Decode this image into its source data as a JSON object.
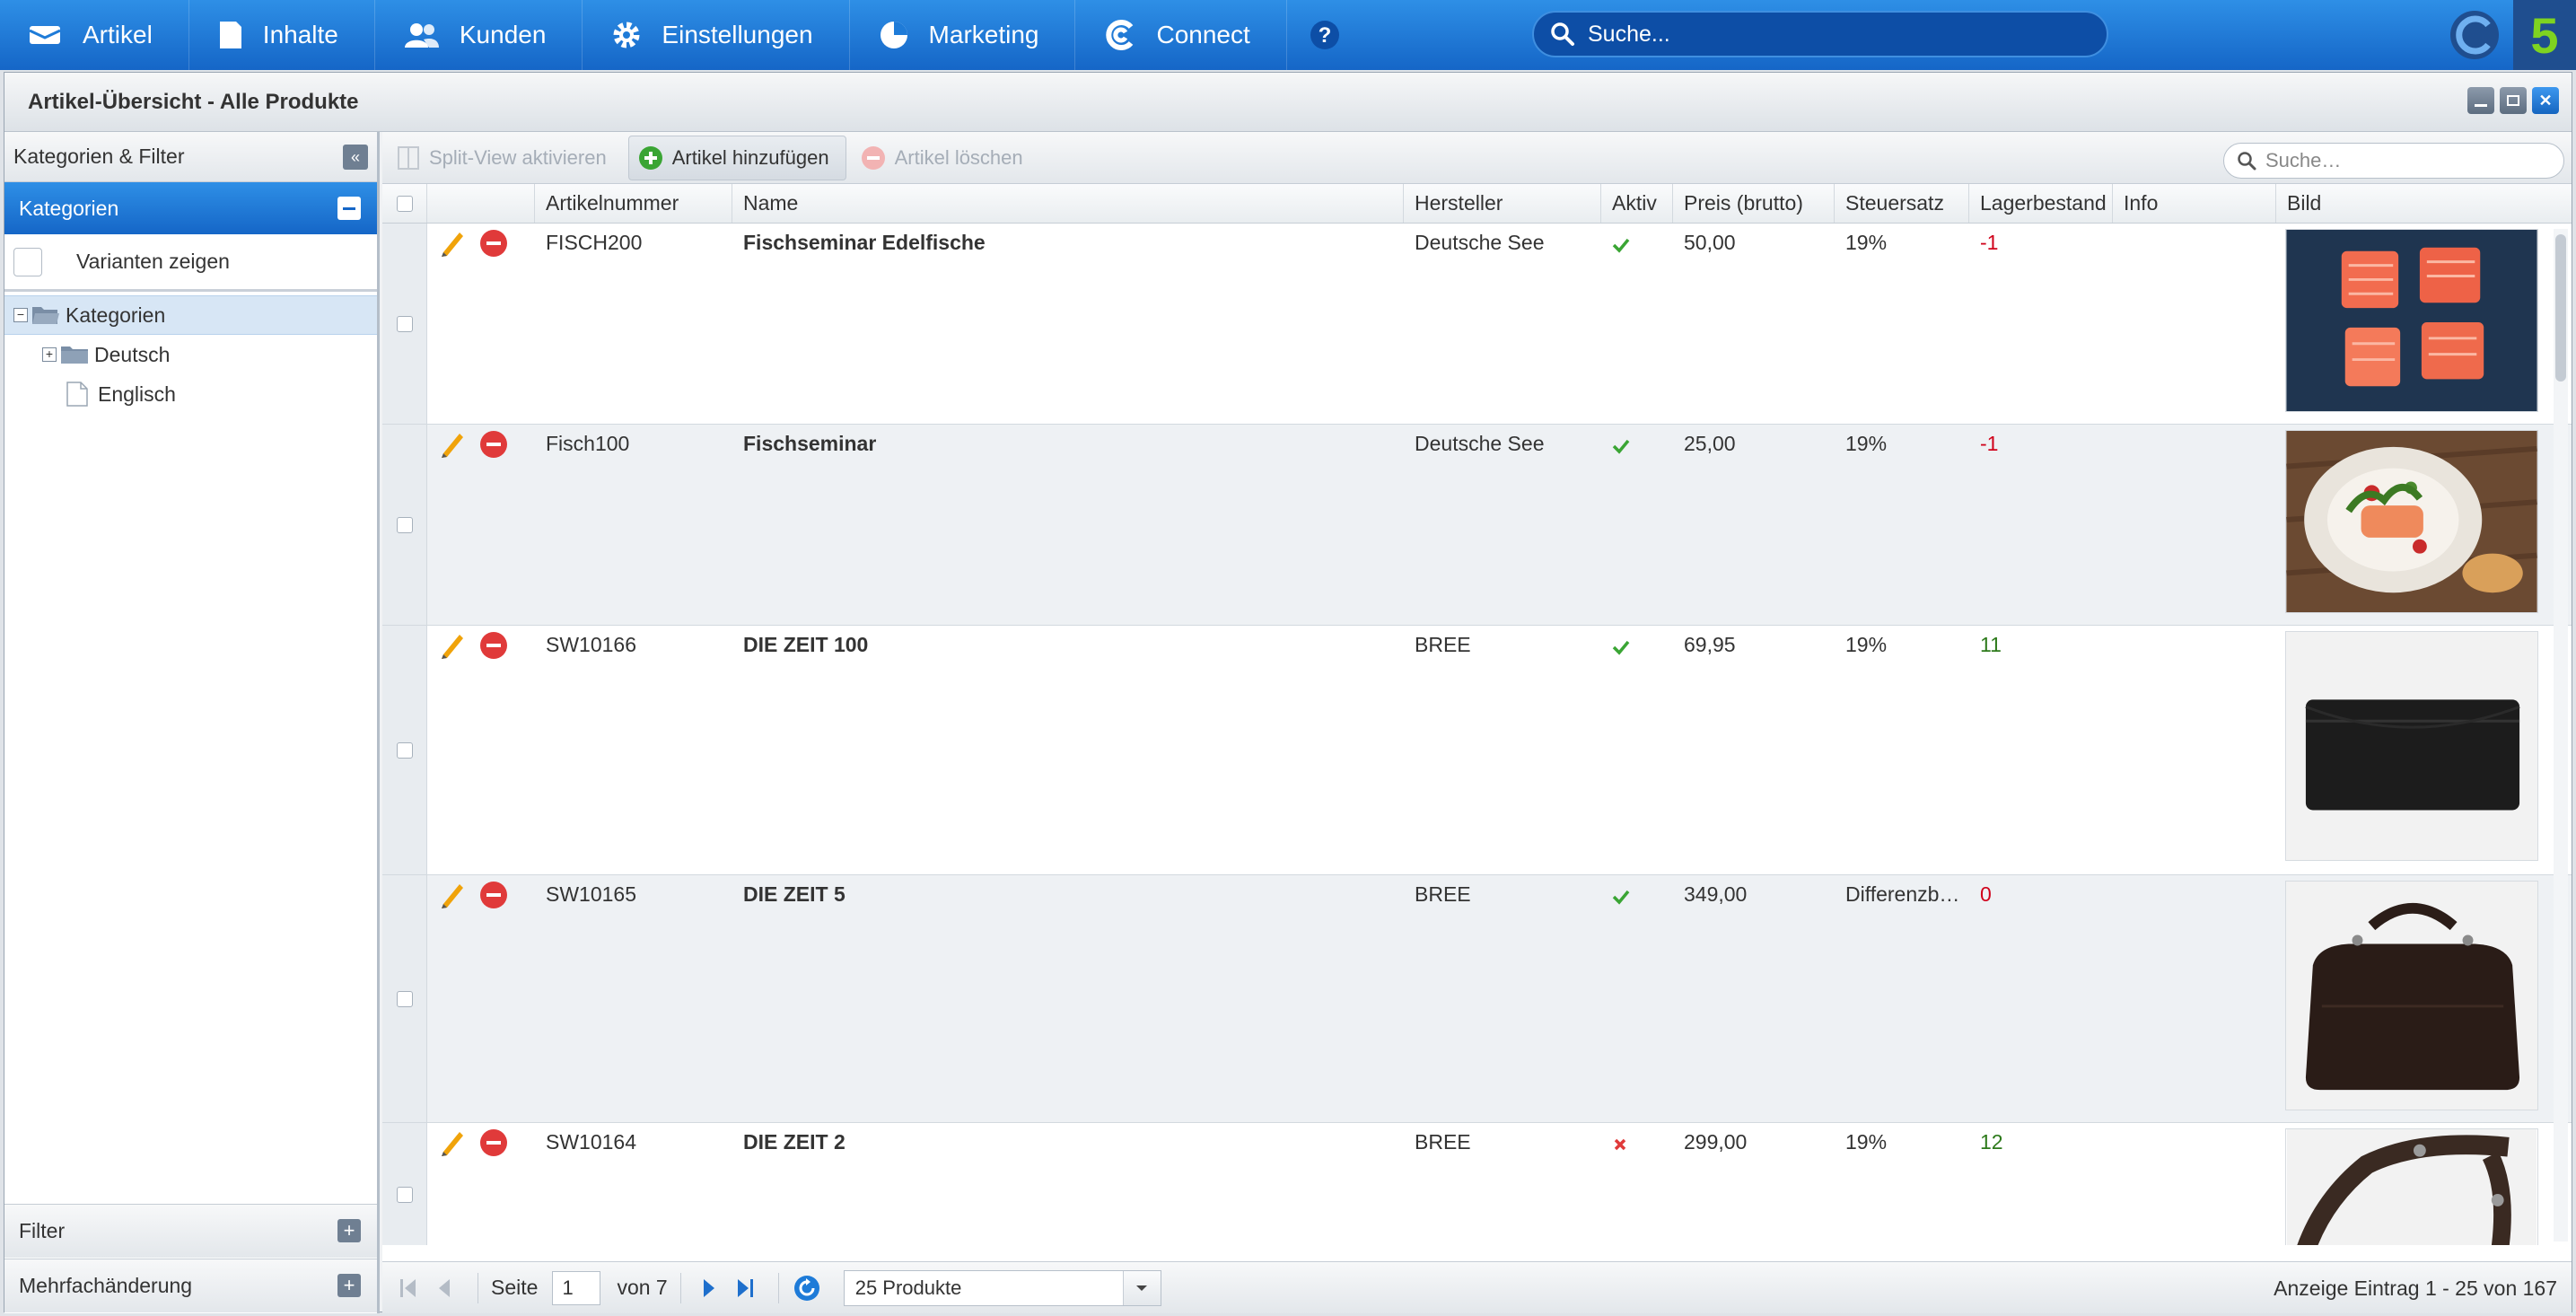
{
  "nav": {
    "items": [
      {
        "label": "Artikel",
        "icon": "artikel-icon"
      },
      {
        "label": "Inhalte",
        "icon": "document-icon"
      },
      {
        "label": "Kunden",
        "icon": "users-icon"
      },
      {
        "label": "Einstellungen",
        "icon": "gear-icon"
      },
      {
        "label": "Marketing",
        "icon": "pie-chart-icon"
      },
      {
        "label": "Connect",
        "icon": "connect-icon"
      }
    ],
    "search_placeholder": "Suche...",
    "brand_glyph": "5"
  },
  "window": {
    "title": "Artikel-Übersicht - Alle Produkte"
  },
  "left": {
    "panel_title": "Kategorien & Filter",
    "categories_title": "Kategorien",
    "variants_label": "Varianten zeigen",
    "tree": {
      "root": "Kategorien",
      "children": [
        "Deutsch",
        "Englisch"
      ]
    },
    "filter_label": "Filter",
    "bulk_label": "Mehrfachänderung"
  },
  "toolbar": {
    "split_view": "Split-View aktivieren",
    "add": "Artikel hinzufügen",
    "delete": "Artikel löschen",
    "search_placeholder": "Suche…"
  },
  "grid": {
    "columns": [
      "Artikelnummer",
      "Name",
      "Hersteller",
      "Aktiv",
      "Preis (brutto)",
      "Steuersatz",
      "Lagerbestand",
      "Info",
      "Bild"
    ],
    "rows": [
      {
        "number": "FISCH200",
        "name": "Fischseminar Edelfische",
        "manufacturer": "Deutsche See",
        "active": true,
        "price": "50,00",
        "tax": "19%",
        "stock": "-1",
        "info": ""
      },
      {
        "number": "Fisch100",
        "name": "Fischseminar",
        "manufacturer": "Deutsche See",
        "active": true,
        "price": "25,00",
        "tax": "19%",
        "stock": "-1",
        "info": ""
      },
      {
        "number": "SW10166",
        "name": "DIE ZEIT 100",
        "manufacturer": "BREE",
        "active": true,
        "price": "69,95",
        "tax": "19%",
        "stock": "11",
        "info": ""
      },
      {
        "number": "SW10165",
        "name": "DIE ZEIT 5",
        "manufacturer": "BREE",
        "active": true,
        "price": "349,00",
        "tax": "Differenzb…",
        "stock": "0",
        "info": ""
      },
      {
        "number": "SW10164",
        "name": "DIE ZEIT 2",
        "manufacturer": "BREE",
        "active": false,
        "price": "299,00",
        "tax": "19%",
        "stock": "12",
        "info": ""
      }
    ]
  },
  "pager": {
    "page_label": "Seite",
    "page_value": "1",
    "of_label": "von 7",
    "per_page": "25 Produkte",
    "info": "Anzeige Eintrag 1 - 25 von 167"
  },
  "colors": {
    "accent": "#1e7bd8",
    "negative": "#d0021b",
    "positive": "#2d7a1b",
    "brand_green": "#7ed321"
  }
}
